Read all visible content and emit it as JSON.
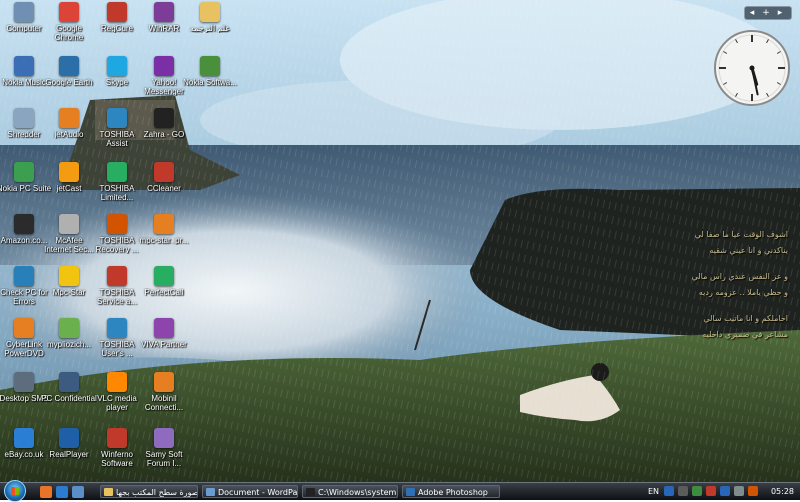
{
  "desktop": {
    "icons": [
      {
        "label": "Computer",
        "icon": "computer-icon",
        "color": "#6f8fb3"
      },
      {
        "label": "Google Chrome",
        "icon": "chrome-icon",
        "color": "#db4437"
      },
      {
        "label": "RegCure",
        "icon": "regcure-icon",
        "color": "#c0392b"
      },
      {
        "label": "WinRAR",
        "icon": "winrar-icon",
        "color": "#7d3c98"
      },
      {
        "label": "علم الترجمه",
        "icon": "folder-icon",
        "color": "#e8c160"
      },
      {
        "label": "Nokia Music",
        "icon": "nokia-music-icon",
        "color": "#3a6fb5"
      },
      {
        "label": "Google Earth",
        "icon": "google-earth-icon",
        "color": "#2c6ea8"
      },
      {
        "label": "Skype",
        "icon": "skype-icon",
        "color": "#1ea7e1"
      },
      {
        "label": "Yahoo! Messenger",
        "icon": "yahoo-messenger-icon",
        "color": "#7b2fa6"
      },
      {
        "label": "Nokia Softwa...",
        "icon": "nokia-software-icon",
        "color": "#4a8f3c"
      },
      {
        "label": "Shredder",
        "icon": "shredder-icon",
        "color": "#8aa5c0"
      },
      {
        "label": "jetAudio",
        "icon": "jetaudio-icon",
        "color": "#e67e22"
      },
      {
        "label": "TOSHIBA Assist",
        "icon": "toshiba-assist-icon",
        "color": "#2e86c1"
      },
      {
        "label": "Zahra - GO",
        "icon": "zahra-go-icon",
        "color": "#222222"
      },
      {
        "label": "Nokia PC Suite",
        "icon": "nokia-pc-suite-icon",
        "color": "#3c9e4f"
      },
      {
        "label": "jetCast",
        "icon": "jetcast-icon",
        "color": "#f39c12"
      },
      {
        "label": "TOSHIBA Limited...",
        "icon": "toshiba-limited-icon",
        "color": "#27ae60"
      },
      {
        "label": "CCleaner",
        "icon": "ccleaner-icon",
        "color": "#c0392b"
      },
      {
        "label": "Amazon.co...",
        "icon": "amazon-icon",
        "color": "#2b2b2b"
      },
      {
        "label": "McAfee Internet Sec...",
        "icon": "mcafee-icon",
        "color": "#b0b0b0"
      },
      {
        "label": "TOSHIBA Recovery ...",
        "icon": "toshiba-recovery-icon",
        "color": "#d35400"
      },
      {
        "label": "mpc-star_pr...",
        "icon": "mpc-star-icon",
        "color": "#e67e22"
      },
      {
        "label": "Check PC for Errors",
        "icon": "check-pc-icon",
        "color": "#2980b9"
      },
      {
        "label": "Mpc-Star",
        "icon": "mpc-star-app-icon",
        "color": "#f1c40f"
      },
      {
        "label": "TOSHIBA Service a...",
        "icon": "toshiba-service-icon",
        "color": "#c0392b"
      },
      {
        "label": "PerfectCall",
        "icon": "perfectcall-icon",
        "color": "#27ae60"
      },
      {
        "label": "CyberLink PowerDVD",
        "icon": "powerdvd-icon",
        "color": "#e67e22"
      },
      {
        "label": "mypliozich...",
        "icon": "mypliozich-icon",
        "color": "#6ab04c"
      },
      {
        "label": "TOSHIBA User's ...",
        "icon": "toshiba-users-icon",
        "color": "#2e86c1"
      },
      {
        "label": "VIVA Partner",
        "icon": "viva-partner-icon",
        "color": "#8e44ad"
      },
      {
        "label": "Desktop SMS",
        "icon": "desktop-sms-icon",
        "color": "#5d6d7e"
      },
      {
        "label": "PC Confidential",
        "icon": "pc-confidential-icon",
        "color": "#3d5a80"
      },
      {
        "label": "VLC media player",
        "icon": "vlc-icon",
        "color": "#ff8800"
      },
      {
        "label": "Mobinil Connecti...",
        "icon": "mobinil-icon",
        "color": "#e67e22"
      },
      {
        "label": "eBay.co.uk",
        "icon": "ebay-icon",
        "color": "#2a7fd4"
      },
      {
        "label": "RealPlayer",
        "icon": "realplayer-icon",
        "color": "#1f5fa8"
      },
      {
        "label": "Winferno Software",
        "icon": "winferno-icon",
        "color": "#c0392b"
      },
      {
        "label": "Samy Soft Forum I...",
        "icon": "samy-soft-icon",
        "color": "#8e6bbf"
      }
    ]
  },
  "wallpaper": {
    "text_lines": [
      "اشوف الوقت عيا ما صفا لي",
      "يناكدني و انا عيني شقيه",
      "و عز النفس عندي راس مالي",
      "و حظي ياملا .. عزومه رديه",
      "احاملكم و انا ماتيب سالي",
      "مشاعر في ضميري داخليه"
    ]
  },
  "gadgets": {
    "clock": {
      "hour": 5,
      "minute": 28
    },
    "sidebar_add": "+"
  },
  "taskbar": {
    "buttons": [
      {
        "label": "صورة سطح المكتب بجها...",
        "icon": "folder-icon",
        "color": "#e8c160"
      },
      {
        "label": "Document - WordPad",
        "icon": "wordpad-icon",
        "color": "#6a9bd1"
      },
      {
        "label": "C:\\Windows\\system...",
        "icon": "cmd-icon",
        "color": "#222222"
      },
      {
        "label": "Adobe Photoshop",
        "icon": "photoshop-icon",
        "color": "#2f6fb3"
      }
    ],
    "language": "EN",
    "time": "05:28"
  }
}
